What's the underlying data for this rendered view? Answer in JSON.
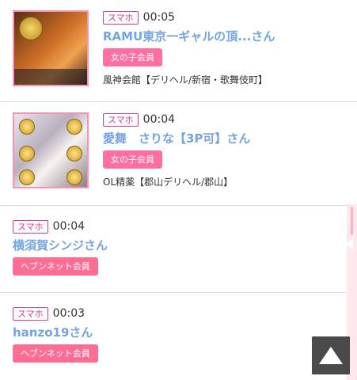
{
  "feed": [
    {
      "device": "スマホ",
      "time": "00:05",
      "name": "RAMU東京一ギャルの頂...さん",
      "tag": "女の子会員",
      "shop": "風神会館【デリヘル/新宿・歌舞伎町】",
      "has_thumb": true
    },
    {
      "device": "スマホ",
      "time": "00:04",
      "name": "愛舞　さりな【3P可】さん",
      "tag": "女の子会員",
      "shop": "OL精薬【郡山デリヘル/郡山】",
      "has_thumb": true
    },
    {
      "device": "スマホ",
      "time": "00:04",
      "name": "横須賀シンジさん",
      "tag": "ヘブンネット会員"
    },
    {
      "device": "スマホ",
      "time": "00:03",
      "name": "hanzo19さん",
      "tag": "ヘブンネット会員"
    }
  ],
  "icons": {
    "back_to_top": "up-triangle-icon"
  },
  "colors": {
    "device_border": "#d63c98",
    "name_link": "#74a4e4",
    "tag_bg": "#ff6fa1",
    "thumb_border": "#ff8fb6",
    "scrollbar_track": "#ffe9ec"
  }
}
